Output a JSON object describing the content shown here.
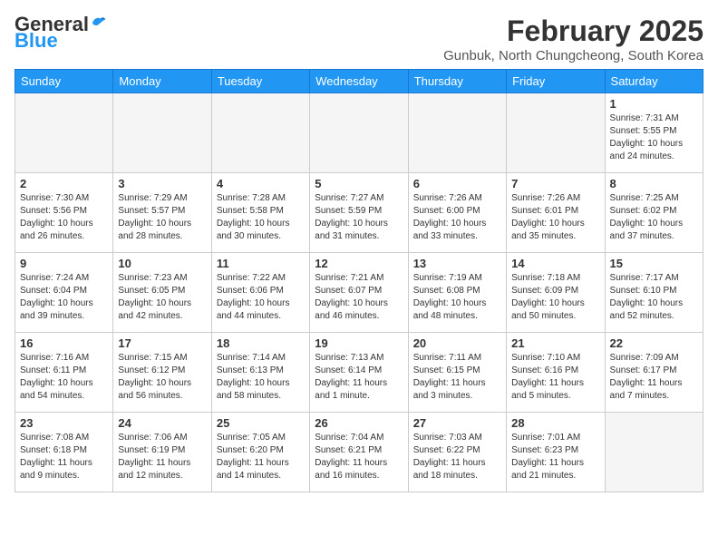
{
  "logo": {
    "general": "General",
    "blue": "Blue"
  },
  "title": "February 2025",
  "subtitle": "Gunbuk, North Chungcheong, South Korea",
  "days_of_week": [
    "Sunday",
    "Monday",
    "Tuesday",
    "Wednesday",
    "Thursday",
    "Friday",
    "Saturday"
  ],
  "weeks": [
    [
      {
        "day": "",
        "info": ""
      },
      {
        "day": "",
        "info": ""
      },
      {
        "day": "",
        "info": ""
      },
      {
        "day": "",
        "info": ""
      },
      {
        "day": "",
        "info": ""
      },
      {
        "day": "",
        "info": ""
      },
      {
        "day": "1",
        "info": "Sunrise: 7:31 AM\nSunset: 5:55 PM\nDaylight: 10 hours and 24 minutes."
      }
    ],
    [
      {
        "day": "2",
        "info": "Sunrise: 7:30 AM\nSunset: 5:56 PM\nDaylight: 10 hours and 26 minutes."
      },
      {
        "day": "3",
        "info": "Sunrise: 7:29 AM\nSunset: 5:57 PM\nDaylight: 10 hours and 28 minutes."
      },
      {
        "day": "4",
        "info": "Sunrise: 7:28 AM\nSunset: 5:58 PM\nDaylight: 10 hours and 30 minutes."
      },
      {
        "day": "5",
        "info": "Sunrise: 7:27 AM\nSunset: 5:59 PM\nDaylight: 10 hours and 31 minutes."
      },
      {
        "day": "6",
        "info": "Sunrise: 7:26 AM\nSunset: 6:00 PM\nDaylight: 10 hours and 33 minutes."
      },
      {
        "day": "7",
        "info": "Sunrise: 7:26 AM\nSunset: 6:01 PM\nDaylight: 10 hours and 35 minutes."
      },
      {
        "day": "8",
        "info": "Sunrise: 7:25 AM\nSunset: 6:02 PM\nDaylight: 10 hours and 37 minutes."
      }
    ],
    [
      {
        "day": "9",
        "info": "Sunrise: 7:24 AM\nSunset: 6:04 PM\nDaylight: 10 hours and 39 minutes."
      },
      {
        "day": "10",
        "info": "Sunrise: 7:23 AM\nSunset: 6:05 PM\nDaylight: 10 hours and 42 minutes."
      },
      {
        "day": "11",
        "info": "Sunrise: 7:22 AM\nSunset: 6:06 PM\nDaylight: 10 hours and 44 minutes."
      },
      {
        "day": "12",
        "info": "Sunrise: 7:21 AM\nSunset: 6:07 PM\nDaylight: 10 hours and 46 minutes."
      },
      {
        "day": "13",
        "info": "Sunrise: 7:19 AM\nSunset: 6:08 PM\nDaylight: 10 hours and 48 minutes."
      },
      {
        "day": "14",
        "info": "Sunrise: 7:18 AM\nSunset: 6:09 PM\nDaylight: 10 hours and 50 minutes."
      },
      {
        "day": "15",
        "info": "Sunrise: 7:17 AM\nSunset: 6:10 PM\nDaylight: 10 hours and 52 minutes."
      }
    ],
    [
      {
        "day": "16",
        "info": "Sunrise: 7:16 AM\nSunset: 6:11 PM\nDaylight: 10 hours and 54 minutes."
      },
      {
        "day": "17",
        "info": "Sunrise: 7:15 AM\nSunset: 6:12 PM\nDaylight: 10 hours and 56 minutes."
      },
      {
        "day": "18",
        "info": "Sunrise: 7:14 AM\nSunset: 6:13 PM\nDaylight: 10 hours and 58 minutes."
      },
      {
        "day": "19",
        "info": "Sunrise: 7:13 AM\nSunset: 6:14 PM\nDaylight: 11 hours and 1 minute."
      },
      {
        "day": "20",
        "info": "Sunrise: 7:11 AM\nSunset: 6:15 PM\nDaylight: 11 hours and 3 minutes."
      },
      {
        "day": "21",
        "info": "Sunrise: 7:10 AM\nSunset: 6:16 PM\nDaylight: 11 hours and 5 minutes."
      },
      {
        "day": "22",
        "info": "Sunrise: 7:09 AM\nSunset: 6:17 PM\nDaylight: 11 hours and 7 minutes."
      }
    ],
    [
      {
        "day": "23",
        "info": "Sunrise: 7:08 AM\nSunset: 6:18 PM\nDaylight: 11 hours and 9 minutes."
      },
      {
        "day": "24",
        "info": "Sunrise: 7:06 AM\nSunset: 6:19 PM\nDaylight: 11 hours and 12 minutes."
      },
      {
        "day": "25",
        "info": "Sunrise: 7:05 AM\nSunset: 6:20 PM\nDaylight: 11 hours and 14 minutes."
      },
      {
        "day": "26",
        "info": "Sunrise: 7:04 AM\nSunset: 6:21 PM\nDaylight: 11 hours and 16 minutes."
      },
      {
        "day": "27",
        "info": "Sunrise: 7:03 AM\nSunset: 6:22 PM\nDaylight: 11 hours and 18 minutes."
      },
      {
        "day": "28",
        "info": "Sunrise: 7:01 AM\nSunset: 6:23 PM\nDaylight: 11 hours and 21 minutes."
      },
      {
        "day": "",
        "info": ""
      }
    ]
  ]
}
